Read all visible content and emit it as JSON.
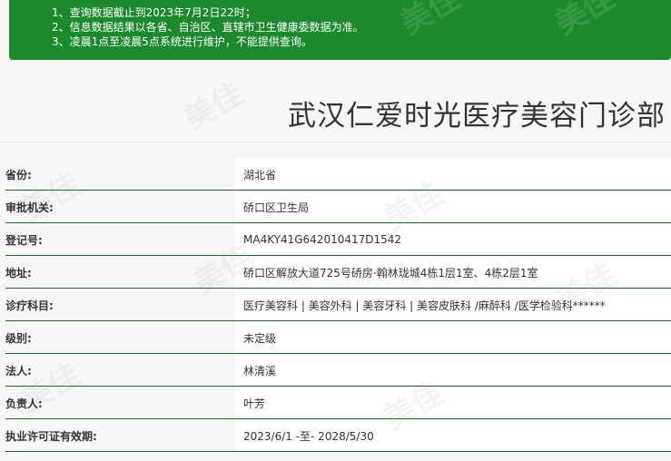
{
  "notice": {
    "lines": [
      "1、查询数据截止到2023年7月2日22时；",
      "2、信息数据结果以各省、自治区、直辖市卫生健康委数据为准。",
      "3、凌晨1点至凌晨5点系统进行维护，不能提供查询。"
    ]
  },
  "title": "武汉仁爱时光医疗美容门诊部",
  "details": [
    {
      "label": "省份:",
      "value": "湖北省"
    },
    {
      "label": "审批机关:",
      "value": "硚口区卫生局"
    },
    {
      "label": "登记号:",
      "value": "MA4KY41G642010417D1542"
    },
    {
      "label": "地址:",
      "value": "硚口区解放大道725号硚房·翰林珑城4栋1层1室、4栋2层1室"
    },
    {
      "label": "诊疗科目:",
      "value": "医疗美容科 | 美容外科 | 美容牙科 | 美容皮肤科 /麻醉科 /医学检验科******"
    },
    {
      "label": "级别:",
      "value": "未定级"
    },
    {
      "label": "法人:",
      "value": "林清溪"
    },
    {
      "label": "负责人:",
      "value": "叶芳"
    },
    {
      "label": "执业许可证有效期:",
      "value": "2023/6/1 -至- 2028/5/30"
    }
  ],
  "watermark_text": "美佳",
  "colors": {
    "notice_bg": "#1c8a2c",
    "row_divider": "#1a6b2a",
    "page_bg": "#f7f7f7"
  }
}
